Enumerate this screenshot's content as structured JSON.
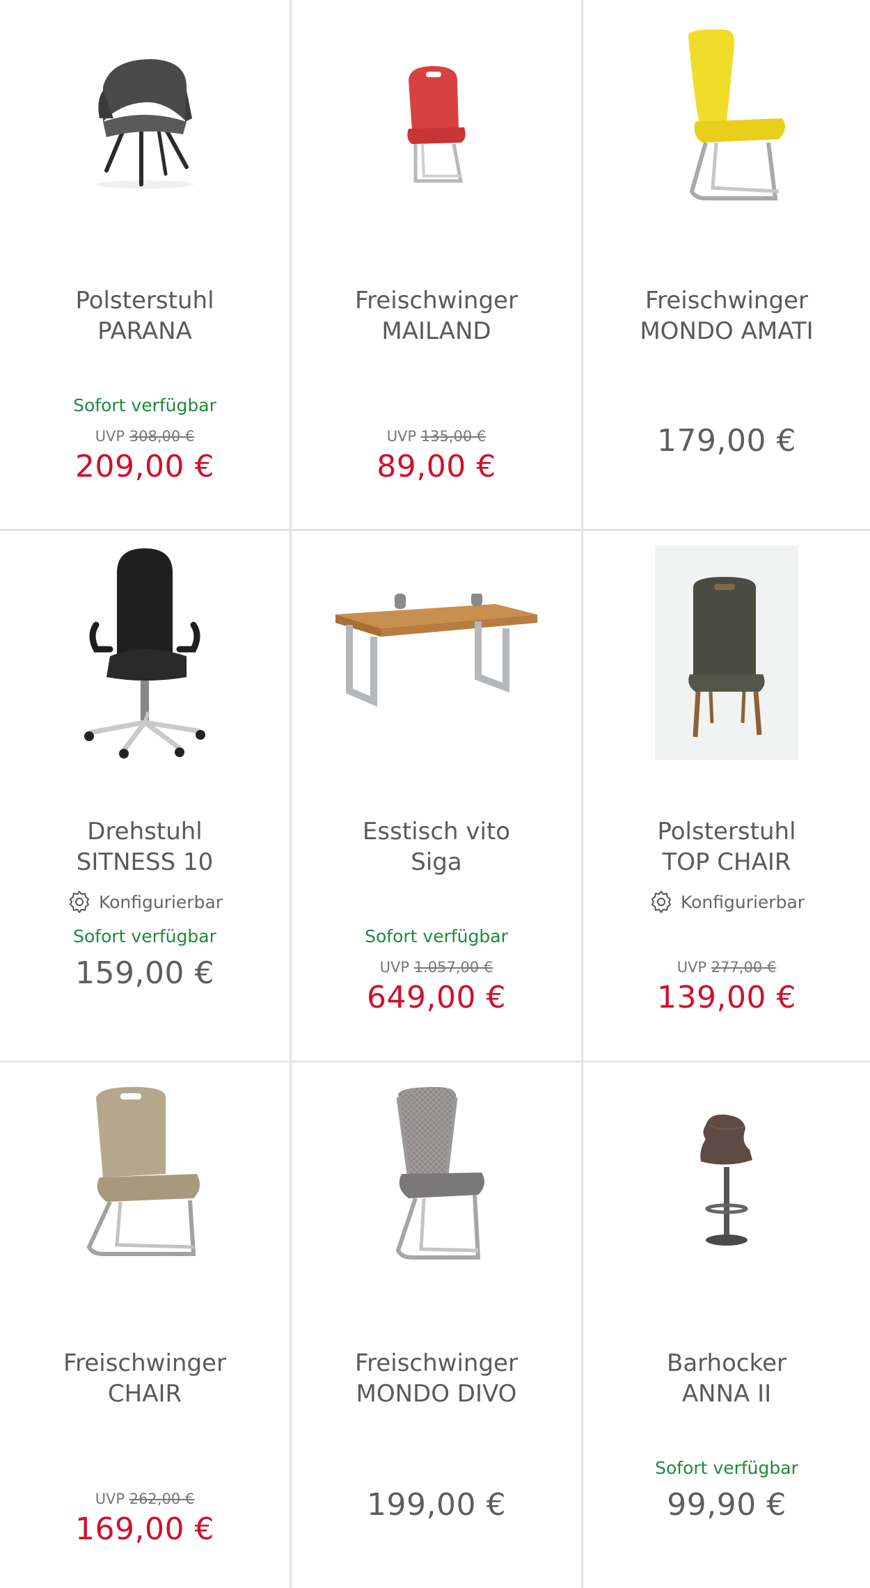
{
  "products": [
    {
      "title_line1": "Polsterstuhl",
      "title_line2": "PARANA",
      "configurable": "",
      "availability": "Sofort verfügbar",
      "uvp_label": "UVP",
      "uvp_price": "308,00 €",
      "price": "209,00 €",
      "image": "armchair-dark-grey"
    },
    {
      "title_line1": "Freischwinger",
      "title_line2": "MAILAND",
      "configurable": "",
      "availability": "",
      "uvp_label": "UVP",
      "uvp_price": "135,00 €",
      "price": "89,00 €",
      "image": "cantilever-chair-red"
    },
    {
      "title_line1": "Freischwinger",
      "title_line2": "MONDO AMATI",
      "configurable": "",
      "availability": "",
      "uvp_label": "",
      "uvp_price": "",
      "price": "179,00 €",
      "image": "cantilever-chair-yellow"
    },
    {
      "title_line1": "Drehstuhl",
      "title_line2": "SITNESS 10",
      "configurable": "Konfigurierbar",
      "availability": "Sofort verfügbar",
      "uvp_label": "",
      "uvp_price": "",
      "price": "159,00 €",
      "image": "office-chair-black"
    },
    {
      "title_line1": "Esstisch vito",
      "title_line2": "Siga",
      "configurable": "",
      "availability": "Sofort verfügbar",
      "uvp_label": "UVP",
      "uvp_price": "1.057,00 €",
      "price": "649,00 €",
      "image": "dining-table-wood"
    },
    {
      "title_line1": "Polsterstuhl",
      "title_line2": "TOP CHAIR",
      "configurable": "Konfigurierbar",
      "availability": "",
      "uvp_label": "UVP",
      "uvp_price": "277,00 €",
      "price": "139,00 €",
      "image": "upholstered-chair-olive"
    },
    {
      "title_line1": "Freischwinger",
      "title_line2": "CHAIR",
      "configurable": "",
      "availability": "",
      "uvp_label": "UVP",
      "uvp_price": "262,00 €",
      "price": "169,00 €",
      "image": "cantilever-chair-beige"
    },
    {
      "title_line1": "Freischwinger",
      "title_line2": "MONDO DIVO",
      "configurable": "",
      "availability": "",
      "uvp_label": "",
      "uvp_price": "",
      "price": "199,00 €",
      "image": "cantilever-chair-grey-mesh"
    },
    {
      "title_line1": "Barhocker",
      "title_line2": "ANNA II",
      "configurable": "",
      "availability": "Sofort verfügbar",
      "uvp_label": "",
      "uvp_price": "",
      "price": "99,90 €",
      "image": "bar-stool-brown"
    }
  ],
  "colors": {
    "sale_price": "#d0102b",
    "regular_price": "#5e5e5e",
    "availability": "#1e8a3a",
    "divider": "#e4e4e4"
  }
}
